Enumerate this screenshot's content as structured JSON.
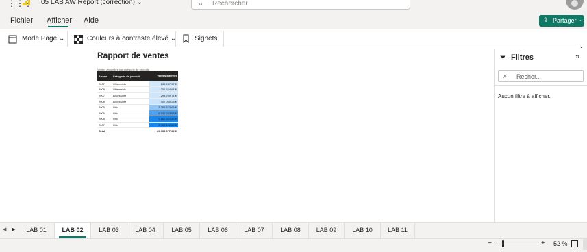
{
  "app": {
    "report_title": "05 LAB AW Report (correction)",
    "search_placeholder": "Rechercher",
    "icons": {
      "apps": "waffle-icon",
      "logo": "powerbi-logo-icon",
      "avatar": "user-avatar-icon"
    }
  },
  "menu": {
    "items": [
      "Fichier",
      "Afficher",
      "Aide"
    ],
    "active": "Afficher",
    "share_label": "Partager"
  },
  "toolbar": {
    "mode_page": "Mode Page",
    "contrast": "Couleurs à contraste élevé",
    "bookmarks": "Signets"
  },
  "report": {
    "heading": "Rapport de ventes",
    "subtitle": "Ventes annuelles par catégorie de produits",
    "columns": [
      "Annee",
      "Catégorie de produit",
      "Ventes Internet"
    ],
    "rows": [
      {
        "year": "2007",
        "category": "Vêtements",
        "sales": "138 247,97 €",
        "shade": "#cfe6fb"
      },
      {
        "year": "2008",
        "category": "Vêtements",
        "sales": "201 524,64 €",
        "shade": "#cfe6fb"
      },
      {
        "year": "2007",
        "category": "Accessoire",
        "sales": "293 709,71 €",
        "shade": "#cde4fb"
      },
      {
        "year": "2008",
        "category": "Accessoire",
        "sales": "407 050,25 €",
        "shade": "#cbe3fb"
      },
      {
        "year": "2005",
        "category": "Vélo",
        "sales": "3 266 373,66 €",
        "shade": "#8fc4f6"
      },
      {
        "year": "2006",
        "category": "Vélo",
        "sales": "6 530 343,53 €",
        "shade": "#4ea1f0"
      },
      {
        "year": "2008",
        "category": "Vélo",
        "sales": "9 162 324,85 €",
        "shade": "#1a86ea"
      },
      {
        "year": "2007",
        "category": "Vélo",
        "sales": "9 359 102,62 €",
        "shade": "#1684e9"
      }
    ],
    "total_label": "Total",
    "total_value": "29 358 677,22 €"
  },
  "filters": {
    "title": "Filtres",
    "search_placeholder": "Recher...",
    "empty_text": "Aucun filtre à afficher."
  },
  "pages": {
    "tabs": [
      "LAB 01",
      "LAB 02",
      "LAB 03",
      "LAB 04",
      "LAB 05",
      "LAB 06",
      "LAB 07",
      "LAB 08",
      "LAB 09",
      "LAB 10",
      "LAB 11"
    ],
    "active": "LAB 02"
  },
  "status": {
    "zoom": "52 %",
    "zoom_fraction": 0.2
  },
  "colors": {
    "accent": "#117865",
    "header_bg": "#252423",
    "chrome_bg": "#f3f2f1"
  }
}
